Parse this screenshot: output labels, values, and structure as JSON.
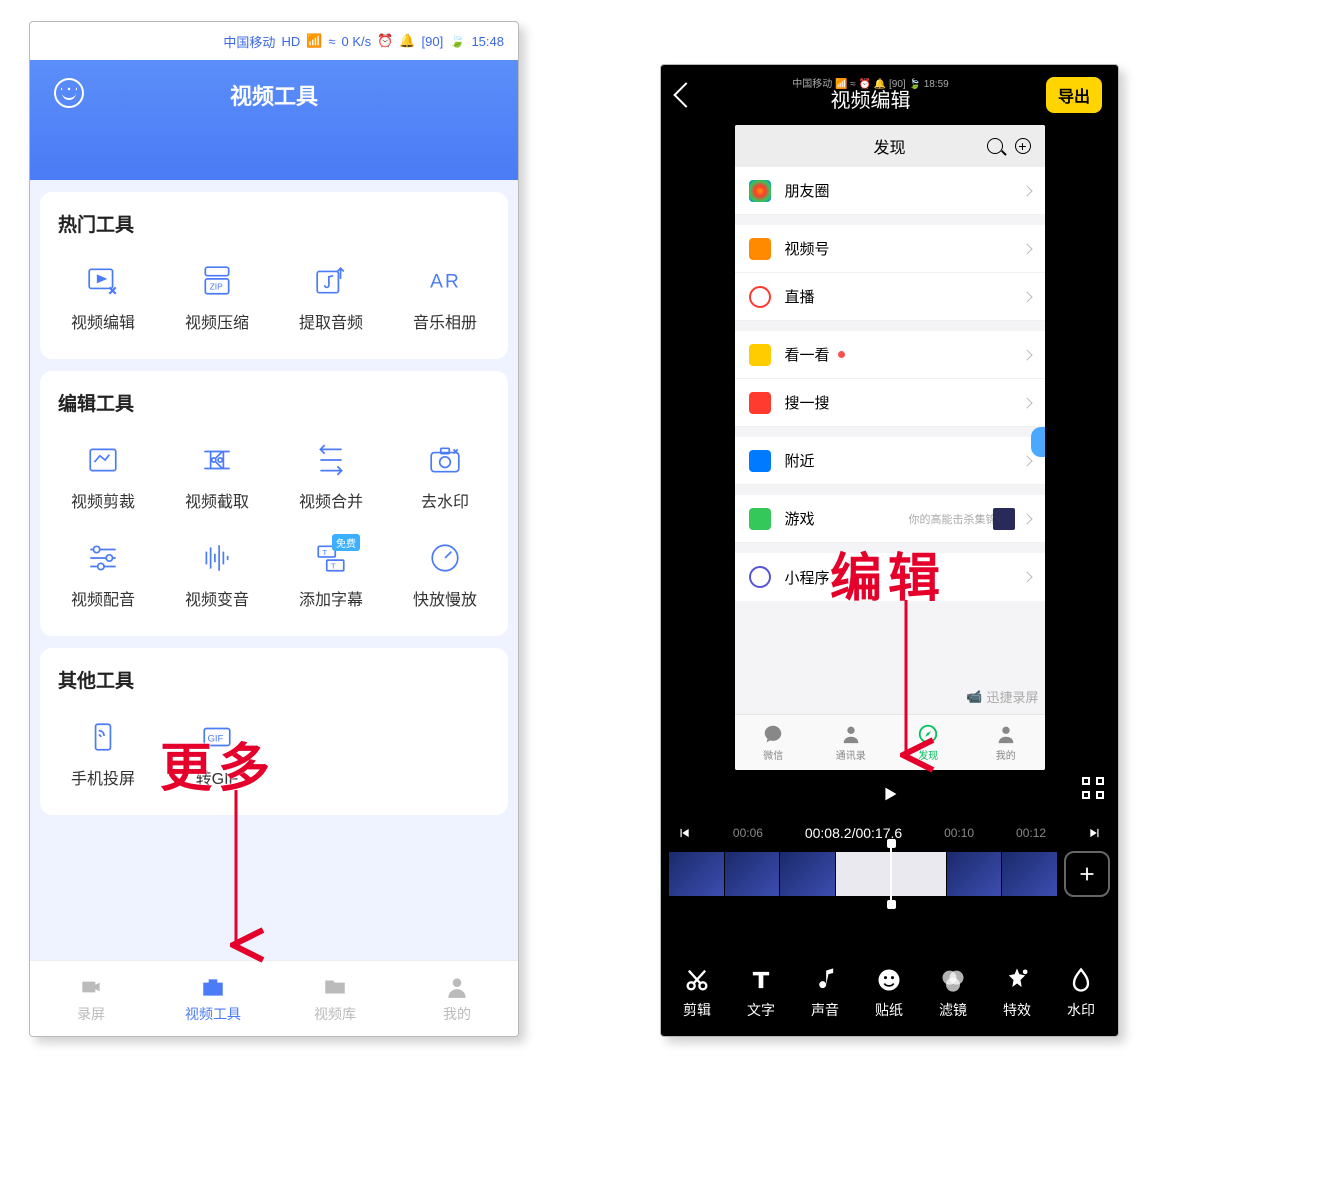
{
  "left": {
    "status": {
      "carrier": "中国移动",
      "net": "HD",
      "wifi": "⁴⁶",
      "speed": "0 K/s",
      "battery": "90",
      "time": "15:48"
    },
    "title": "视频工具",
    "sections": [
      {
        "title": "热门工具",
        "items": [
          {
            "label": "视频编辑",
            "icon": "play-edit"
          },
          {
            "label": "视频压缩",
            "icon": "zip"
          },
          {
            "label": "提取音频",
            "icon": "music-up"
          },
          {
            "label": "音乐相册",
            "icon": "ar"
          }
        ]
      },
      {
        "title": "编辑工具",
        "items": [
          {
            "label": "视频剪裁",
            "icon": "crop"
          },
          {
            "label": "视频截取",
            "icon": "scissors"
          },
          {
            "label": "视频合并",
            "icon": "merge"
          },
          {
            "label": "去水印",
            "icon": "camera-x"
          },
          {
            "label": "视频配音",
            "icon": "sliders"
          },
          {
            "label": "视频变音",
            "icon": "wave"
          },
          {
            "label": "添加字幕",
            "icon": "subtitle",
            "badge": "免费"
          },
          {
            "label": "快放慢放",
            "icon": "speed"
          }
        ]
      },
      {
        "title": "其他工具",
        "items": [
          {
            "label": "手机投屏",
            "icon": "cast"
          },
          {
            "label": "转GIF",
            "icon": "gif"
          }
        ]
      }
    ],
    "tabs": [
      {
        "label": "录屏",
        "icon": "camera"
      },
      {
        "label": "视频工具",
        "icon": "toolbox",
        "active": true
      },
      {
        "label": "视频库",
        "icon": "folder"
      },
      {
        "label": "我的",
        "icon": "person"
      }
    ],
    "annotation": "更多"
  },
  "right": {
    "status": {
      "carrier": "中国移动",
      "battery": "90",
      "time": "18:59"
    },
    "title": "视频编辑",
    "export": "导出",
    "preview": {
      "header": "发现",
      "items": [
        {
          "label": "朋友圈",
          "color": "#ff9500"
        },
        {
          "label": "视频号",
          "color": "#ff8a00"
        },
        {
          "label": "直播",
          "color": "#ff3b30"
        },
        {
          "label": "看一看",
          "color": "#ffcc00",
          "dot": true
        },
        {
          "label": "搜一搜",
          "color": "#ff3b30"
        },
        {
          "label": "附近",
          "color": "#007aff"
        },
        {
          "label": "游戏",
          "color": "#34c759",
          "sub": "你的高能击杀集锦"
        },
        {
          "label": "小程序",
          "color": "#5856d6"
        }
      ],
      "tabs": [
        {
          "label": "微信"
        },
        {
          "label": "通讯录"
        },
        {
          "label": "发现",
          "active": true
        },
        {
          "label": "我的"
        }
      ],
      "watermark": "迅捷录屏"
    },
    "timeline": {
      "prev": "00:06",
      "current": "00:08.2",
      "total": "00:17.6",
      "next1": "00:10",
      "next2": "00:12"
    },
    "editbar": [
      {
        "label": "剪辑",
        "icon": "cut"
      },
      {
        "label": "文字",
        "icon": "text"
      },
      {
        "label": "声音",
        "icon": "audio"
      },
      {
        "label": "贴纸",
        "icon": "sticker"
      },
      {
        "label": "滤镜",
        "icon": "filter"
      },
      {
        "label": "特效",
        "icon": "fx"
      },
      {
        "label": "水印",
        "icon": "water"
      }
    ],
    "annotation": "编辑"
  }
}
